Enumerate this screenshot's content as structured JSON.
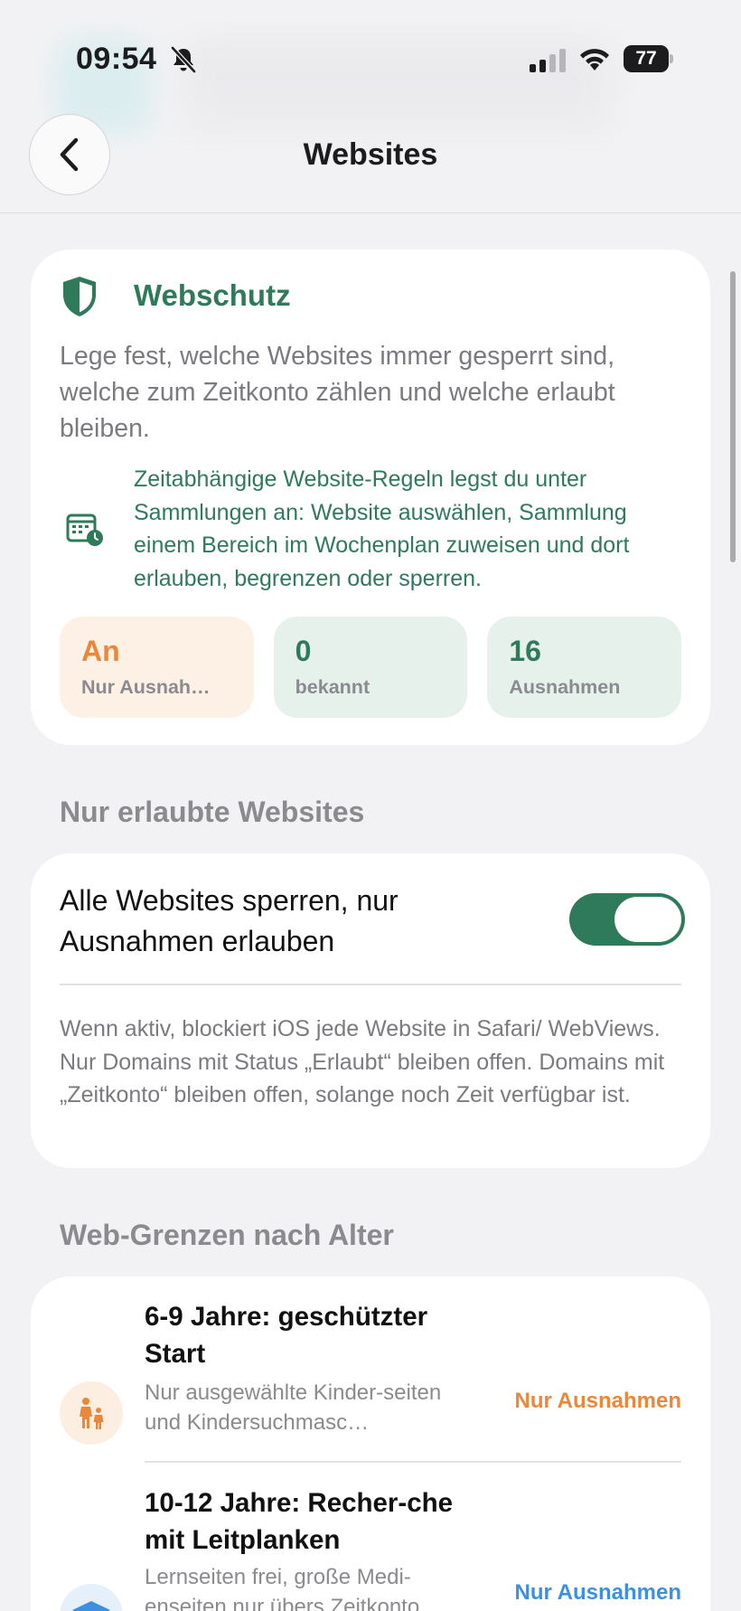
{
  "status_bar": {
    "time": "09:54",
    "battery": "77"
  },
  "nav": {
    "title": "Websites"
  },
  "webschutz": {
    "title": "Webschutz",
    "description": "Lege fest, welche Websites immer gesperrt sind, welche zum Zeitkonto zählen und welche erlaubt bleiben.",
    "note": "Zeitabhängige Website-Regeln legst du unter Sammlungen an: Website auswählen, Sammlung einem Bereich im Wochenplan zuweisen und dort erlauben, begrenzen oder sperren.",
    "stats": [
      {
        "value": "An",
        "label": "Nur Ausnah…"
      },
      {
        "value": "0",
        "label": "bekannt"
      },
      {
        "value": "16",
        "label": "Ausnahmen"
      }
    ]
  },
  "allowed_only": {
    "section_title": "Nur erlaubte Websites",
    "toggle_label": "Alle Websites sperren, nur Ausnahmen erlauben",
    "toggle_on": true,
    "description": "Wenn aktiv, blockiert iOS jede Website in Safari/ WebViews. Nur Domains mit Status „Erlaubt“ bleiben offen. Domains mit „Zeitkonto“ bleiben offen, solange noch Zeit verfügbar ist."
  },
  "age_limits": {
    "section_title": "Web-Grenzen nach Alter",
    "items": [
      {
        "title": "6-9 Jahre: geschützter Start",
        "subtitle": "Nur ausgewählte Kinder-seiten und Kindersuchmasc…",
        "status": "Nur Ausnahmen",
        "icon": "family-icon"
      },
      {
        "title": "10-12 Jahre: Recher-che mit Leitplanken",
        "subtitle": "Lernseiten frei, große Medi-enseiten nur übers Zeitkonto",
        "status": "Nur Ausnahmen",
        "icon": "graduation-cap-icon"
      }
    ]
  },
  "colors": {
    "accent_green": "#2f7a5a",
    "accent_orange": "#e9873a",
    "accent_blue": "#3d8fe0",
    "background": "#f2f2f4"
  }
}
